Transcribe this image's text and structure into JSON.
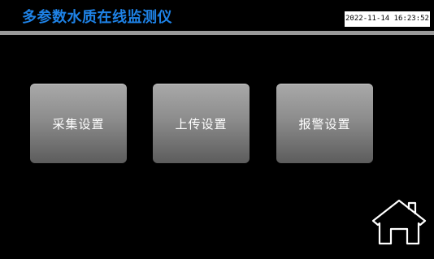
{
  "header": {
    "title": "多参数水质在线监测仪",
    "datetime": "2022-11-14 16:23:52"
  },
  "menu": {
    "collect_settings": "采集设置",
    "upload_settings": "上传设置",
    "alarm_settings": "报警设置"
  },
  "icons": {
    "home": "home-icon"
  },
  "colors": {
    "background": "#000000",
    "title": "#1e82e6",
    "divider": "#9a9a9a",
    "button_top": "#a9a9a9",
    "button_bottom": "#5c5c5c"
  }
}
